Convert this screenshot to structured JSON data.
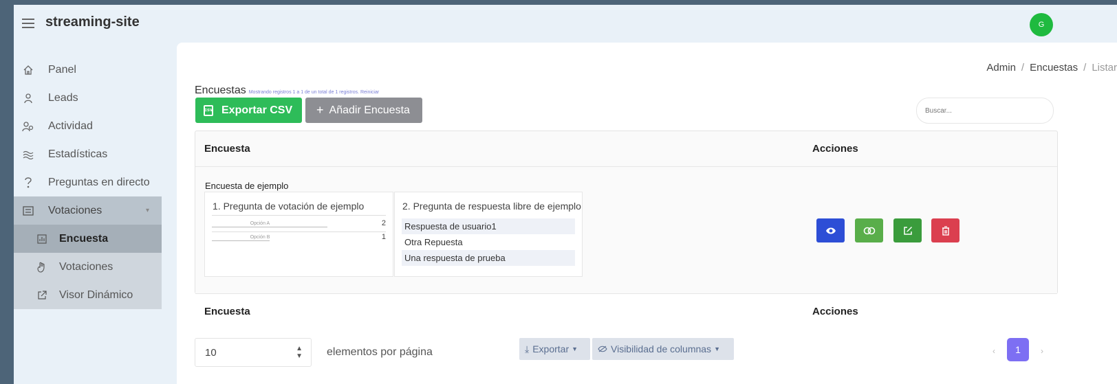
{
  "app": {
    "title": "streaming-site",
    "avatar_initial": "G",
    "avatar_color": "#1fba3f"
  },
  "sidebar": {
    "items": [
      {
        "label": "Panel",
        "icon": "home-icon"
      },
      {
        "label": "Leads",
        "icon": "user-icon"
      },
      {
        "label": "Actividad",
        "icon": "users-icon"
      },
      {
        "label": "Estadísticas",
        "icon": "waves-icon"
      },
      {
        "label": "Preguntas en directo",
        "icon": "question-icon"
      }
    ],
    "group": {
      "label": "Votaciones",
      "icon": "vote-box-icon",
      "children": [
        {
          "label": "Encuesta",
          "icon": "chart-box-icon",
          "active": true
        },
        {
          "label": "Votaciones",
          "icon": "hand-icon"
        },
        {
          "label": "Visor Dinámico",
          "icon": "external-link-icon"
        }
      ]
    }
  },
  "breadcrumb": [
    "Admin",
    "Encuestas",
    "Listar"
  ],
  "page": {
    "title": "Encuestas",
    "subtitle": "Mostrando registros 1 a 1 de un total de 1 registros. Reiniciar"
  },
  "toolbar": {
    "export_csv_label": "Exportar CSV",
    "add_label": "Añadir Encuesta",
    "search_placeholder": "Buscar..."
  },
  "table": {
    "columns": [
      "Encuesta",
      "Acciones"
    ],
    "row": {
      "name": "Encuesta de ejemplo",
      "q1": {
        "title": "1. Pregunta de votación de ejemplo",
        "options": [
          {
            "label": "Opción A",
            "count": "2",
            "fraction": 0.66
          },
          {
            "label": "Opción B",
            "count": "1",
            "fraction": 0.33
          }
        ]
      },
      "q2": {
        "title": "2. Pregunta de respuesta libre de ejemplo",
        "answers": [
          "Respuesta de usuario1",
          "Otra Repuesta",
          "Una respuesta de prueba"
        ]
      },
      "actions": [
        "view-icon",
        "toggle-icon",
        "edit-icon",
        "delete-icon"
      ]
    }
  },
  "pagination": {
    "per_page": "10",
    "per_page_label": "elementos por página",
    "export_label": "Exportar",
    "visibility_label": "Visibilidad de columnas",
    "current_page": "1",
    "accent": "#7d6ff3"
  }
}
